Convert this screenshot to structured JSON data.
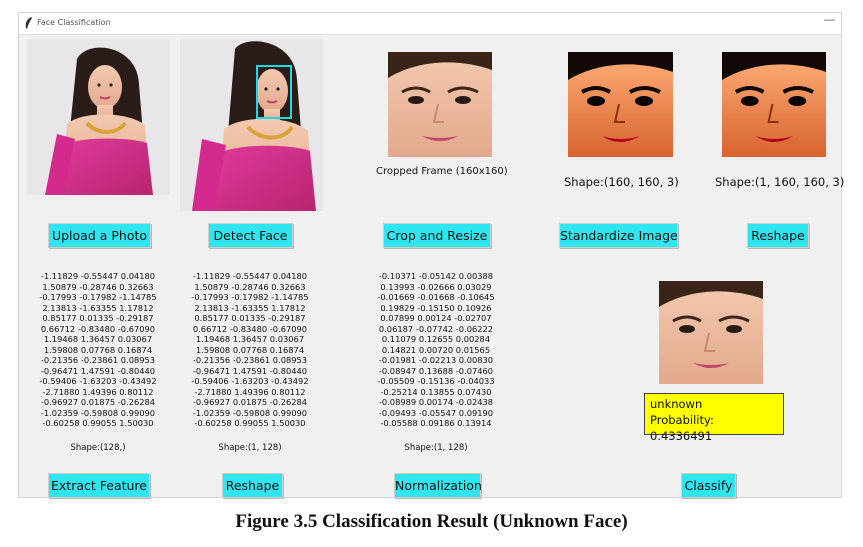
{
  "window": {
    "title": "Face Classification",
    "minimize_glyph": "—"
  },
  "images": [
    {
      "name": "uploaded-photo",
      "description_icon": "portrait-photo"
    },
    {
      "name": "detected-face-photo",
      "description_icon": "portrait-photo-with-face-box"
    },
    {
      "name": "cropped-face",
      "description_icon": "face-closeup"
    },
    {
      "name": "standardized-face",
      "description_icon": "face-closeup-high-contrast"
    },
    {
      "name": "reshaped-face",
      "description_icon": "face-closeup-high-contrast"
    },
    {
      "name": "classified-face",
      "description_icon": "face-closeup"
    }
  ],
  "captions": {
    "cropped": "Cropped Frame (160x160)",
    "standardized_shape": "Shape:(160, 160, 3)",
    "reshaped_shape": "Shape:(1, 160, 160, 3)"
  },
  "buttons": {
    "upload": "Upload a Photo",
    "detect": "Detect Face",
    "crop": "Crop and Resize",
    "standardize": "Standardize Image",
    "reshape_image": "Reshape",
    "extract": "Extract Feature",
    "reshape_feature": "Reshape",
    "normalize": "Normalization",
    "classify": "Classify"
  },
  "feature_vector": {
    "lines": [
      "-1.11829 -0.55447 0.04180",
      "1.50879 -0.28746 0.32663",
      "-0.17993 -0.17982 -1.14785",
      "2.13813 -1.63355 1.17812",
      "0.85177 0.01335 -0.29187",
      "0.66712 -0.83480 -0.67090",
      "1.19468 1.36457 0.03067",
      "1.59808 0.07768 0.16874",
      "-0.21356 -0.23861 0.08953",
      "-0.96471 1.47591 -0.80440",
      "-0.59406 -1.63203 -0.43492",
      "-2.71880 1.49396 0.80112",
      "-0.96927 0.01875 -0.26284",
      "-1.02359 -0.59808 0.99090",
      "-0.60258 0.99055 1.50030"
    ],
    "shape": "Shape:(128,)"
  },
  "reshaped_vector": {
    "lines": [
      "-1.11829 -0.55447 0.04180",
      "1.50879 -0.28746 0.32663",
      "-0.17993 -0.17982 -1.14785",
      "2.13813 -1.63355 1.17812",
      "0.85177 0.01335 -0.29187",
      "0.66712 -0.83480 -0.67090",
      "1.19468 1.36457 0.03067",
      "1.59808 0.07768 0.16874",
      "-0.21356 -0.23861 0.08953",
      "-0.96471 1.47591 -0.80440",
      "-0.59406 -1.63203 -0.43492",
      "-2.71880 1.49396 0.80112",
      "-0.96927 0.01875 -0.26284",
      "-1.02359 -0.59808 0.99090",
      "-0.60258 0.99055 1.50030"
    ],
    "shape": "Shape:(1, 128)"
  },
  "normalized_vector": {
    "lines": [
      "-0.10371 -0.05142 0.00388",
      "0.13993 -0.02666 0.03029",
      "-0.01669 -0.01668 -0.10645",
      "0.19829 -0.15150 0.10926",
      "0.07899 0.00124 -0.02707",
      "0.06187 -0.07742 -0.06222",
      "0.11079 0.12655 0.00284",
      "0.14821 0.00720 0.01565",
      "-0.01981 -0.02213 0.00830",
      "-0.08947 0.13688 -0.07460",
      "-0.05509 -0.15136 -0.04033",
      "-0.25214 0.13855 0.07430",
      "-0.08989 0.00174 -0.02438",
      "-0.09493 -0.05547 0.09190",
      "-0.05588 0.09186 0.13914"
    ],
    "shape": "Shape:(1, 128)"
  },
  "result": {
    "label": "unknown",
    "probability": "Probability: 0.4336491"
  },
  "figure_caption": "Figure 3.5 Classification Result (Unknown Face)"
}
